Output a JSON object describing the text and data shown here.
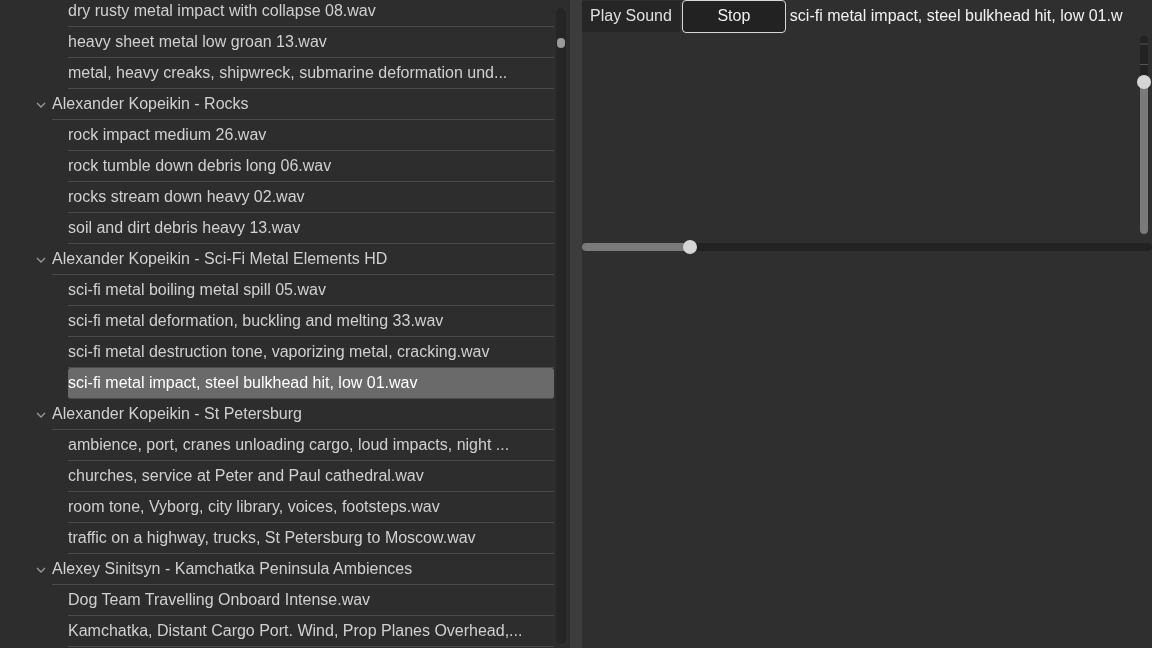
{
  "tree": [
    {
      "kind": "file",
      "label": "dry rusty metal impact with collapse 08.wav",
      "selected": false
    },
    {
      "kind": "file",
      "label": "heavy sheet metal low groan 13.wav",
      "selected": false
    },
    {
      "kind": "file",
      "label": "metal, heavy creaks, shipwreck, submarine deformation und...",
      "selected": false
    },
    {
      "kind": "folder",
      "label": "Alexander Kopeikin - Rocks",
      "expanded": true,
      "children": [
        {
          "kind": "file",
          "label": "rock impact medium 26.wav",
          "selected": false
        },
        {
          "kind": "file",
          "label": "rock tumble down debris long 06.wav",
          "selected": false
        },
        {
          "kind": "file",
          "label": "rocks stream down heavy 02.wav",
          "selected": false
        },
        {
          "kind": "file",
          "label": "soil and dirt debris heavy 13.wav",
          "selected": false
        }
      ]
    },
    {
      "kind": "folder",
      "label": "Alexander Kopeikin - Sci-Fi Metal Elements HD",
      "expanded": true,
      "children": [
        {
          "kind": "file",
          "label": "sci-fi metal boiling metal spill 05.wav",
          "selected": false
        },
        {
          "kind": "file",
          "label": "sci-fi metal deformation, buckling and melting 33.wav",
          "selected": false
        },
        {
          "kind": "file",
          "label": "sci-fi metal destruction tone, vaporizing metal, cracking.wav",
          "selected": false
        },
        {
          "kind": "file",
          "label": "sci-fi metal impact, steel bulkhead hit, low 01.wav",
          "selected": true
        }
      ]
    },
    {
      "kind": "folder",
      "label": "Alexander Kopeikin - St Petersburg",
      "expanded": true,
      "children": [
        {
          "kind": "file",
          "label": "ambience, port, cranes unloading cargo, loud impacts, night ...",
          "selected": false
        },
        {
          "kind": "file",
          "label": "churches, service at Peter and Paul cathedral.wav",
          "selected": false
        },
        {
          "kind": "file",
          "label": "room tone, Vyborg, city library, voices, footsteps.wav",
          "selected": false
        },
        {
          "kind": "file",
          "label": "traffic on a highway, trucks, St Petersburg to Moscow.wav",
          "selected": false
        }
      ]
    },
    {
      "kind": "folder",
      "label": "Alexey Sinitsyn - Kamchatka Peninsula Ambiences",
      "expanded": true,
      "children": [
        {
          "kind": "file",
          "label": "Dog Team Travelling Onboard Intense.wav",
          "selected": false
        },
        {
          "kind": "file",
          "label": "Kamchatka, Distant Cargo Port. Wind, Prop Planes Overhead,...",
          "selected": false
        }
      ]
    }
  ],
  "player": {
    "play_button": "Play Sound",
    "stop_button": "Stop",
    "now_playing": "sci-fi metal impact, steel bulkhead hit, low 01.w",
    "volume": {
      "level": 0.77
    },
    "position": {
      "level": 0.19
    }
  }
}
